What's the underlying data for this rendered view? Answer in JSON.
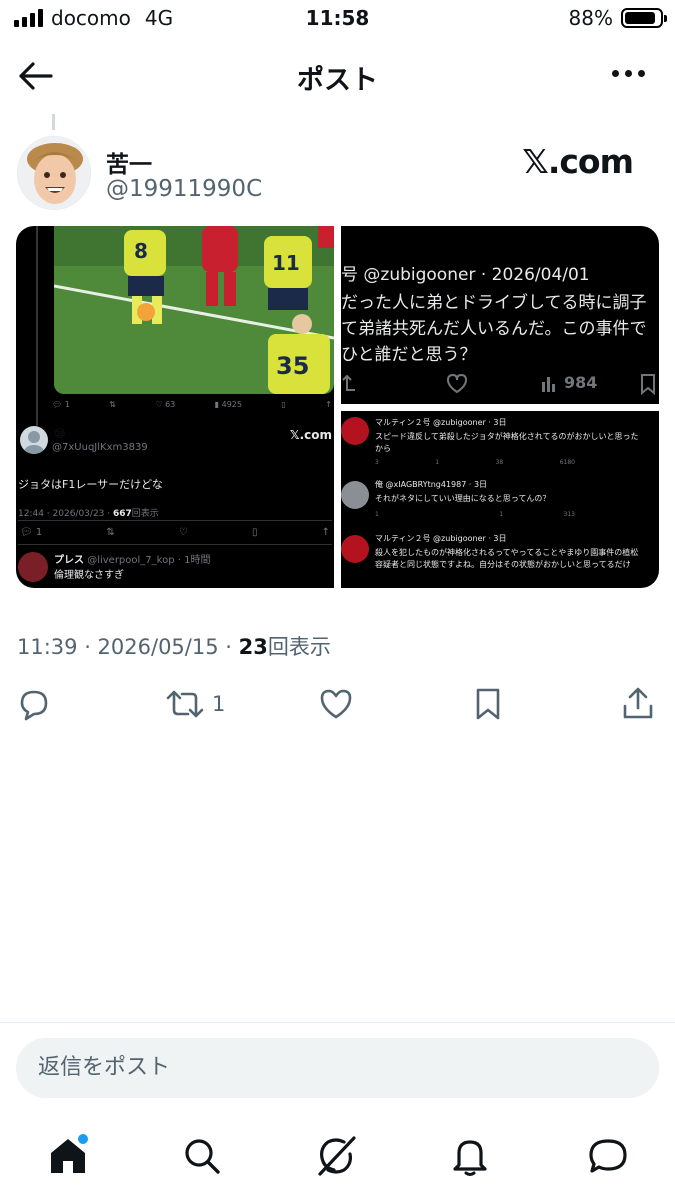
{
  "status_bar": {
    "carrier": "docomo",
    "network": "4G",
    "time": "11:58",
    "battery": "88%",
    "battery_level": 0.88
  },
  "header": {
    "title": "ポスト"
  },
  "post": {
    "author_name": "苦一",
    "author_handle": "@19911990C",
    "source_logo": "𝕏.com",
    "timestamp": "11:39 · 2026/05/15 · ",
    "views_count": "23",
    "views_label": "回表示",
    "retweet_count": "1"
  },
  "media": {
    "tile_a": {
      "stat_reply": "1",
      "stat_like": "63",
      "stat_views": "4925",
      "quoted_emoji": "😪",
      "quoted_handle": "@7xUuqJlKxm3839",
      "quoted_logo": "𝕏.com",
      "quoted_text": "ジョタはF1レーサーだけどな",
      "quoted_time": "12:44 · 2026/03/23 · ",
      "quoted_views": "667",
      "quoted_views_label": "回表示",
      "quoted_reply_count": "1",
      "reply_name": "プレス",
      "reply_handle": "@liverpool_7_kop · 1時間",
      "reply_text": "倫理観なさすぎ"
    },
    "tile_b": {
      "line1": "号 @zubigooner · 2026/04/01",
      "line2": "だった人に弟とドライブしてる時に調子",
      "line3": "て弟諸共死んだ人いるんだ。この事件で",
      "line4": "ひと誰だと思う？",
      "views": "984"
    },
    "tile_c": {
      "r1_name": "マルティン２号 @zubigooner · 3日",
      "r1_text1": "スピード違反して弟殺したジョタが神格化されてるのがおかしいと思った",
      "r1_text2": "から",
      "r1_stats": [
        "3",
        "1",
        "38",
        "6180"
      ],
      "r2_name": "俺 @xIAGBRYtng41987 · 3日",
      "r2_text": "それがネタにしていい理由になると思ってんの？",
      "r2_stats": [
        "1",
        "",
        "1",
        "313"
      ],
      "r3_name": "マルティン２号 @zubigooner · 3日",
      "r3_text1": "殺人を犯したものが神格化されるってやってることやまゆり園事件の植松",
      "r3_text2": "容疑者と同じ状態ですよね。自分はその状態がおかしいと思ってるだけ"
    }
  },
  "reply_input": {
    "placeholder": "返信をポスト"
  },
  "colors": {
    "accent": "#1d9bf0",
    "text": "#0f1419",
    "muted": "#536471"
  }
}
